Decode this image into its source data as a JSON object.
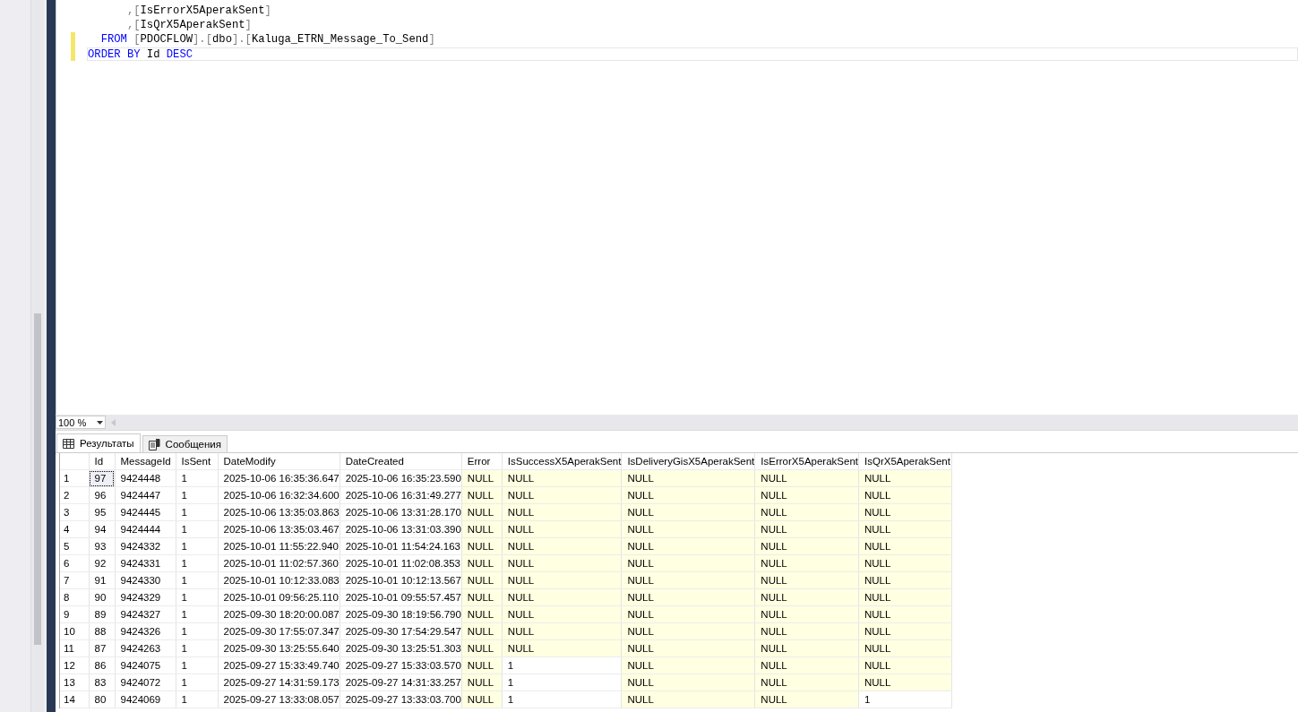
{
  "editor": {
    "lines": [
      {
        "changed": false,
        "current": false,
        "tokens": [
          {
            "kind": "punct",
            "text": "      ,"
          },
          {
            "kind": "punct",
            "text": "["
          },
          {
            "kind": "ident",
            "text": "IsErrorX5AperakSent"
          },
          {
            "kind": "punct",
            "text": "]"
          }
        ]
      },
      {
        "changed": false,
        "current": false,
        "tokens": [
          {
            "kind": "punct",
            "text": "      ,"
          },
          {
            "kind": "punct",
            "text": "["
          },
          {
            "kind": "ident",
            "text": "IsQrX5AperakSent"
          },
          {
            "kind": "punct",
            "text": "]"
          }
        ]
      },
      {
        "changed": true,
        "current": false,
        "tokens": [
          {
            "kind": "keyword",
            "text": "  FROM "
          },
          {
            "kind": "punct",
            "text": "["
          },
          {
            "kind": "ident",
            "text": "PDOCFLOW"
          },
          {
            "kind": "punct",
            "text": "].["
          },
          {
            "kind": "ident",
            "text": "dbo"
          },
          {
            "kind": "punct",
            "text": "].["
          },
          {
            "kind": "ident",
            "text": "Kaluga_ETRN_Message_To_Send"
          },
          {
            "kind": "punct",
            "text": "]"
          }
        ]
      },
      {
        "changed": true,
        "current": true,
        "tokens": [
          {
            "kind": "keyword",
            "text": "ORDER BY "
          },
          {
            "kind": "ident",
            "text": "Id "
          },
          {
            "kind": "keyword",
            "text": "DESC"
          }
        ]
      }
    ]
  },
  "zoom": {
    "value": "100 %"
  },
  "tabs": [
    {
      "label": "Результаты",
      "selected": true
    },
    {
      "label": "Сообщения",
      "selected": false
    }
  ],
  "table": {
    "columns": [
      "Id",
      "MessageId",
      "IsSent",
      "DateModify",
      "DateCreated",
      "Error",
      "IsSuccessX5AperakSent",
      "IsDeliveryGisX5AperakSent",
      "IsErrorX5AperakSent",
      "IsQrX5AperakSent"
    ],
    "rows": [
      {
        "number": "1",
        "current": true,
        "cells": [
          {
            "text": "97",
            "null": false
          },
          {
            "text": "9424448",
            "null": false
          },
          {
            "text": "1",
            "null": false
          },
          {
            "text": "2025-10-06 16:35:36.647",
            "null": false
          },
          {
            "text": "2025-10-06 16:35:23.590",
            "null": false
          },
          {
            "text": "NULL",
            "null": true
          },
          {
            "text": "NULL",
            "null": true
          },
          {
            "text": "NULL",
            "null": true
          },
          {
            "text": "NULL",
            "null": true
          },
          {
            "text": "NULL",
            "null": true
          }
        ]
      },
      {
        "number": "2",
        "current": false,
        "cells": [
          {
            "text": "96",
            "null": false
          },
          {
            "text": "9424447",
            "null": false
          },
          {
            "text": "1",
            "null": false
          },
          {
            "text": "2025-10-06 16:32:34.600",
            "null": false
          },
          {
            "text": "2025-10-06 16:31:49.277",
            "null": false
          },
          {
            "text": "NULL",
            "null": true
          },
          {
            "text": "NULL",
            "null": true
          },
          {
            "text": "NULL",
            "null": true
          },
          {
            "text": "NULL",
            "null": true
          },
          {
            "text": "NULL",
            "null": true
          }
        ]
      },
      {
        "number": "3",
        "current": false,
        "cells": [
          {
            "text": "95",
            "null": false
          },
          {
            "text": "9424445",
            "null": false
          },
          {
            "text": "1",
            "null": false
          },
          {
            "text": "2025-10-06 13:35:03.863",
            "null": false
          },
          {
            "text": "2025-10-06 13:31:28.170",
            "null": false
          },
          {
            "text": "NULL",
            "null": true
          },
          {
            "text": "NULL",
            "null": true
          },
          {
            "text": "NULL",
            "null": true
          },
          {
            "text": "NULL",
            "null": true
          },
          {
            "text": "NULL",
            "null": true
          }
        ]
      },
      {
        "number": "4",
        "current": false,
        "cells": [
          {
            "text": "94",
            "null": false
          },
          {
            "text": "9424444",
            "null": false
          },
          {
            "text": "1",
            "null": false
          },
          {
            "text": "2025-10-06 13:35:03.467",
            "null": false
          },
          {
            "text": "2025-10-06 13:31:03.390",
            "null": false
          },
          {
            "text": "NULL",
            "null": true
          },
          {
            "text": "NULL",
            "null": true
          },
          {
            "text": "NULL",
            "null": true
          },
          {
            "text": "NULL",
            "null": true
          },
          {
            "text": "NULL",
            "null": true
          }
        ]
      },
      {
        "number": "5",
        "current": false,
        "cells": [
          {
            "text": "93",
            "null": false
          },
          {
            "text": "9424332",
            "null": false
          },
          {
            "text": "1",
            "null": false
          },
          {
            "text": "2025-10-01 11:55:22.940",
            "null": false
          },
          {
            "text": "2025-10-01 11:54:24.163",
            "null": false
          },
          {
            "text": "NULL",
            "null": true
          },
          {
            "text": "NULL",
            "null": true
          },
          {
            "text": "NULL",
            "null": true
          },
          {
            "text": "NULL",
            "null": true
          },
          {
            "text": "NULL",
            "null": true
          }
        ]
      },
      {
        "number": "6",
        "current": false,
        "cells": [
          {
            "text": "92",
            "null": false
          },
          {
            "text": "9424331",
            "null": false
          },
          {
            "text": "1",
            "null": false
          },
          {
            "text": "2025-10-01 11:02:57.360",
            "null": false
          },
          {
            "text": "2025-10-01 11:02:08.353",
            "null": false
          },
          {
            "text": "NULL",
            "null": true
          },
          {
            "text": "NULL",
            "null": true
          },
          {
            "text": "NULL",
            "null": true
          },
          {
            "text": "NULL",
            "null": true
          },
          {
            "text": "NULL",
            "null": true
          }
        ]
      },
      {
        "number": "7",
        "current": false,
        "cells": [
          {
            "text": "91",
            "null": false
          },
          {
            "text": "9424330",
            "null": false
          },
          {
            "text": "1",
            "null": false
          },
          {
            "text": "2025-10-01 10:12:33.083",
            "null": false
          },
          {
            "text": "2025-10-01 10:12:13.567",
            "null": false
          },
          {
            "text": "NULL",
            "null": true
          },
          {
            "text": "NULL",
            "null": true
          },
          {
            "text": "NULL",
            "null": true
          },
          {
            "text": "NULL",
            "null": true
          },
          {
            "text": "NULL",
            "null": true
          }
        ]
      },
      {
        "number": "8",
        "current": false,
        "cells": [
          {
            "text": "90",
            "null": false
          },
          {
            "text": "9424329",
            "null": false
          },
          {
            "text": "1",
            "null": false
          },
          {
            "text": "2025-10-01 09:56:25.110",
            "null": false
          },
          {
            "text": "2025-10-01 09:55:57.457",
            "null": false
          },
          {
            "text": "NULL",
            "null": true
          },
          {
            "text": "NULL",
            "null": true
          },
          {
            "text": "NULL",
            "null": true
          },
          {
            "text": "NULL",
            "null": true
          },
          {
            "text": "NULL",
            "null": true
          }
        ]
      },
      {
        "number": "9",
        "current": false,
        "cells": [
          {
            "text": "89",
            "null": false
          },
          {
            "text": "9424327",
            "null": false
          },
          {
            "text": "1",
            "null": false
          },
          {
            "text": "2025-09-30 18:20:00.087",
            "null": false
          },
          {
            "text": "2025-09-30 18:19:56.790",
            "null": false
          },
          {
            "text": "NULL",
            "null": true
          },
          {
            "text": "NULL",
            "null": true
          },
          {
            "text": "NULL",
            "null": true
          },
          {
            "text": "NULL",
            "null": true
          },
          {
            "text": "NULL",
            "null": true
          }
        ]
      },
      {
        "number": "10",
        "current": false,
        "cells": [
          {
            "text": "88",
            "null": false
          },
          {
            "text": "9424326",
            "null": false
          },
          {
            "text": "1",
            "null": false
          },
          {
            "text": "2025-09-30 17:55:07.347",
            "null": false
          },
          {
            "text": "2025-09-30 17:54:29.547",
            "null": false
          },
          {
            "text": "NULL",
            "null": true
          },
          {
            "text": "NULL",
            "null": true
          },
          {
            "text": "NULL",
            "null": true
          },
          {
            "text": "NULL",
            "null": true
          },
          {
            "text": "NULL",
            "null": true
          }
        ]
      },
      {
        "number": "11",
        "current": false,
        "cells": [
          {
            "text": "87",
            "null": false
          },
          {
            "text": "9424263",
            "null": false
          },
          {
            "text": "1",
            "null": false
          },
          {
            "text": "2025-09-30 13:25:55.640",
            "null": false
          },
          {
            "text": "2025-09-30 13:25:51.303",
            "null": false
          },
          {
            "text": "NULL",
            "null": true
          },
          {
            "text": "NULL",
            "null": true
          },
          {
            "text": "NULL",
            "null": true
          },
          {
            "text": "NULL",
            "null": true
          },
          {
            "text": "NULL",
            "null": true
          }
        ]
      },
      {
        "number": "12",
        "current": false,
        "cells": [
          {
            "text": "86",
            "null": false
          },
          {
            "text": "9424075",
            "null": false
          },
          {
            "text": "1",
            "null": false
          },
          {
            "text": "2025-09-27 15:33:49.740",
            "null": false
          },
          {
            "text": "2025-09-27 15:33:03.570",
            "null": false
          },
          {
            "text": "NULL",
            "null": true
          },
          {
            "text": "1",
            "null": false
          },
          {
            "text": "NULL",
            "null": true
          },
          {
            "text": "NULL",
            "null": true
          },
          {
            "text": "NULL",
            "null": true
          }
        ]
      },
      {
        "number": "13",
        "current": false,
        "cells": [
          {
            "text": "83",
            "null": false
          },
          {
            "text": "9424072",
            "null": false
          },
          {
            "text": "1",
            "null": false
          },
          {
            "text": "2025-09-27 14:31:59.173",
            "null": false
          },
          {
            "text": "2025-09-27 14:31:33.257",
            "null": false
          },
          {
            "text": "NULL",
            "null": true
          },
          {
            "text": "1",
            "null": false
          },
          {
            "text": "NULL",
            "null": true
          },
          {
            "text": "NULL",
            "null": true
          },
          {
            "text": "NULL",
            "null": true
          }
        ]
      },
      {
        "number": "14",
        "current": false,
        "cells": [
          {
            "text": "80",
            "null": false
          },
          {
            "text": "9424069",
            "null": false
          },
          {
            "text": "1",
            "null": false
          },
          {
            "text": "2025-09-27 13:33:08.057",
            "null": false
          },
          {
            "text": "2025-09-27 13:33:03.700",
            "null": false
          },
          {
            "text": "NULL",
            "null": true
          },
          {
            "text": "1",
            "null": false
          },
          {
            "text": "NULL",
            "null": true
          },
          {
            "text": "NULL",
            "null": true
          },
          {
            "text": "1",
            "null": false
          }
        ]
      }
    ]
  }
}
